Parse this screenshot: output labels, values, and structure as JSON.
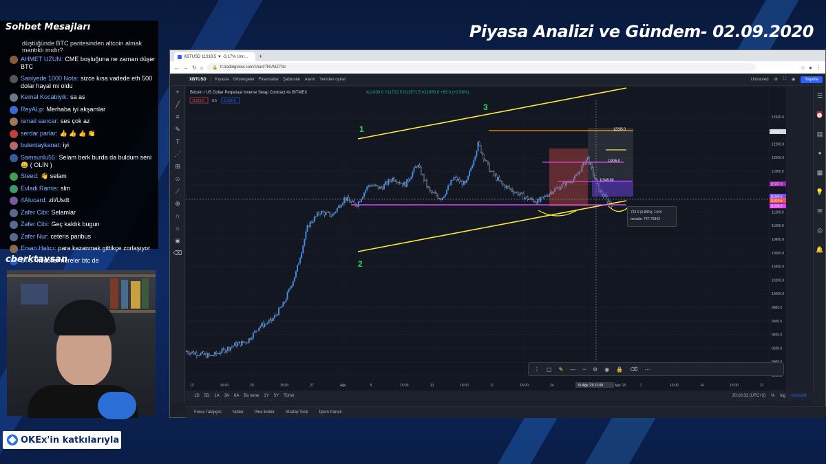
{
  "overlay": {
    "title": "Piyasa Analizi ve Gündem- 02.09.2020",
    "chat_header": "Sohbet Mesajları",
    "streamer": "cberktavsan",
    "sponsor": "OKEx'in katkılarıyla"
  },
  "chat": {
    "top_partial": "düştüğünde BTC paritesinden altcoin almak mantıklı mıdır?",
    "messages": [
      {
        "user": "AHMET UZUN:",
        "text": "CME boşluğuna ne zaman düşer BTC",
        "color": "#8a5a3a"
      },
      {
        "user": "Saniyede 1000 Nota:",
        "text": "sizce kısa vadede eth 500 dolar hayal mi oldu",
        "color": "#555"
      },
      {
        "user": "Kemal Kocabiyik:",
        "text": "sa as",
        "color": "#6a7a8a"
      },
      {
        "user": "ReyALp:",
        "text": "Merhaba iyi akşamlar",
        "color": "#3a6ad0"
      },
      {
        "user": "ismail sancar:",
        "text": "ses çok az",
        "color": "#9a7a5a"
      },
      {
        "user": "serdar parlar:",
        "text": "👍 👍 👍 👏",
        "color": "#c04040"
      },
      {
        "user": "bulentaykanat:",
        "text": "iyi",
        "color": "#b06a6a"
      },
      {
        "user": "Samsunlu55:",
        "text": "Selam berk burda da buldum seni 😀 ( OLİN )",
        "color": "#3a5a9a"
      },
      {
        "user": "Steed:",
        "text": "👋 selam",
        "color": "#40a050"
      },
      {
        "user": "Evladi Ramis:",
        "text": "slm",
        "color": "#3a9a6a"
      },
      {
        "user": "4Alucard:",
        "text": "zil/Usdt",
        "color": "#7a5a9a"
      },
      {
        "user": "Zafer Cibi:",
        "text": "Selamlar",
        "color": "#5a6a8a"
      },
      {
        "user": "Zafer Cibi:",
        "text": "Geç kaldık bugun",
        "color": "#5a6a8a"
      },
      {
        "user": "Zafer Nur:",
        "text": "ceteris paribus",
        "color": "#5a6a8a"
      },
      {
        "user": "Ersan Halıcı:",
        "text": "para kazanmak gittikçe zorlaşıyor",
        "color": "#8a6a4a"
      },
      {
        "user": "BTC:",
        "text": "hedefler nereler btc de",
        "color": "#2a5ad0"
      }
    ]
  },
  "browser": {
    "tab_title": "XBTUSD 11319.5 ▼ -3.17% Unn...",
    "url": "tr.tradingview.com/chart/7RVMZTfd/"
  },
  "tv": {
    "symbol": "XBTUSD",
    "intervals": [
      "1D",
      "5D",
      "1A",
      "3A",
      "6A",
      "Bu sene",
      "1Y",
      "5Y",
      "Tümü"
    ],
    "toolbar_items": [
      "Kıyasla",
      "Göstergeler",
      "Finansallar",
      "Şablonlar",
      "Alarm",
      "Yeniden oynat"
    ],
    "layout_name": "Unnamed",
    "publish": "Yayınla",
    "chart_title": "Bitcoin / US Dollar Perpetual Inverse Swap Contract  4s  BITMEX",
    "ohlc": "A11630.0  Y11722.5  D11571.5  K11695.0  +65.0 (+0.56%)",
    "sell_price": "11319.5",
    "spread": "0.5",
    "buy_price": "11320.0",
    "time": "20:10:32 (UTC+3)",
    "pct": "%",
    "log": "log",
    "auto": "otomatik",
    "panels": [
      "Forex Takipçisi",
      "Notlar",
      "Pine Editör",
      "Strateji Testi",
      "İşlem Paneli"
    ],
    "measure_line1": "722.0 (6.84%), 1444",
    "measure_line2": "mesafe: 747.70843",
    "date_label": "31 Ağu '20   11:00"
  },
  "chart_data": {
    "type": "candlestick",
    "title": "Bitcoin / US Dollar Perpetual Inverse Swap Contract 4s BITMEX",
    "y_ticks": [
      12600,
      12400,
      12200,
      12000,
      11800,
      11600,
      11400,
      11200,
      11000,
      10800,
      10600,
      10400,
      10200,
      10000,
      9800,
      9600,
      9400,
      9200,
      9000,
      8800
    ],
    "x_ticks": [
      "13",
      "15:00",
      "20",
      "15:00",
      "27",
      "Ağu",
      "5",
      "15:00",
      "10",
      "15:00",
      "17",
      "15:00",
      "24",
      "28",
      "31 Ağu '20",
      "7",
      "15:00",
      "14",
      "15:00",
      "21"
    ],
    "ylim": [
      8750,
      12800
    ],
    "price_labels": [
      "12285.0",
      "12296.5",
      "11835.0",
      "11549.80",
      "11567.0",
      "11369.5",
      "11319.5",
      "11203.5"
    ],
    "wave_labels": [
      "1",
      "2",
      "3"
    ],
    "close_approx": [
      9150,
      9120,
      9080,
      9160,
      9250,
      9300,
      9520,
      9600,
      9850,
      10300,
      11000,
      11200,
      11150,
      11400,
      11300,
      11600,
      11550,
      11700,
      11600,
      11900,
      11500,
      11400,
      11700,
      11600,
      12200,
      11800,
      11600,
      11500,
      11400,
      11350,
      11500,
      11600,
      11700,
      12000,
      11500,
      11320
    ]
  }
}
